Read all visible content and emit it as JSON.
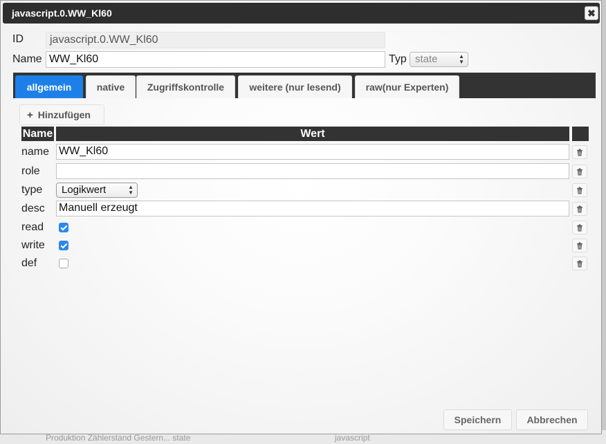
{
  "background": {
    "row_text": "Produktion Zählerstand Gestern... state",
    "row_text2": "javascript"
  },
  "dialog": {
    "title": "javascript.0.WW_Kl60",
    "close_icon": "close-icon",
    "id_label": "ID",
    "id_value": "javascript.0.WW_Kl60",
    "name_label": "Name",
    "name_value": "WW_Kl60",
    "typ_label": "Typ",
    "typ_value": "state"
  },
  "tabs": [
    {
      "label": "allgemein",
      "active": true
    },
    {
      "label": "native",
      "active": false
    },
    {
      "label": "Zugriffskontrolle",
      "active": false
    },
    {
      "label": "weitere (nur lesend)",
      "active": false
    },
    {
      "label": "raw(nur Experten)",
      "active": false
    }
  ],
  "add_button": {
    "label": "Hinzufügen",
    "icon": "plus-icon"
  },
  "table": {
    "headers": {
      "name": "Name",
      "value": "Wert"
    },
    "rows": [
      {
        "name": "name",
        "kind": "text",
        "value": "WW_Kl60"
      },
      {
        "name": "role",
        "kind": "text",
        "value": ""
      },
      {
        "name": "type",
        "kind": "select",
        "value": "Logikwert"
      },
      {
        "name": "desc",
        "kind": "text",
        "value": "Manuell erzeugt"
      },
      {
        "name": "read",
        "kind": "checkbox",
        "checked": true
      },
      {
        "name": "write",
        "kind": "checkbox",
        "checked": true
      },
      {
        "name": "def",
        "kind": "checkbox",
        "checked": false
      }
    ],
    "delete_icon": "trash-icon"
  },
  "footer": {
    "save_label": "Speichern",
    "cancel_label": "Abbrechen"
  },
  "colors": {
    "accent": "#1d80e8",
    "titlebar": "#2e2e2e",
    "checkbox": "#2b87f0"
  }
}
